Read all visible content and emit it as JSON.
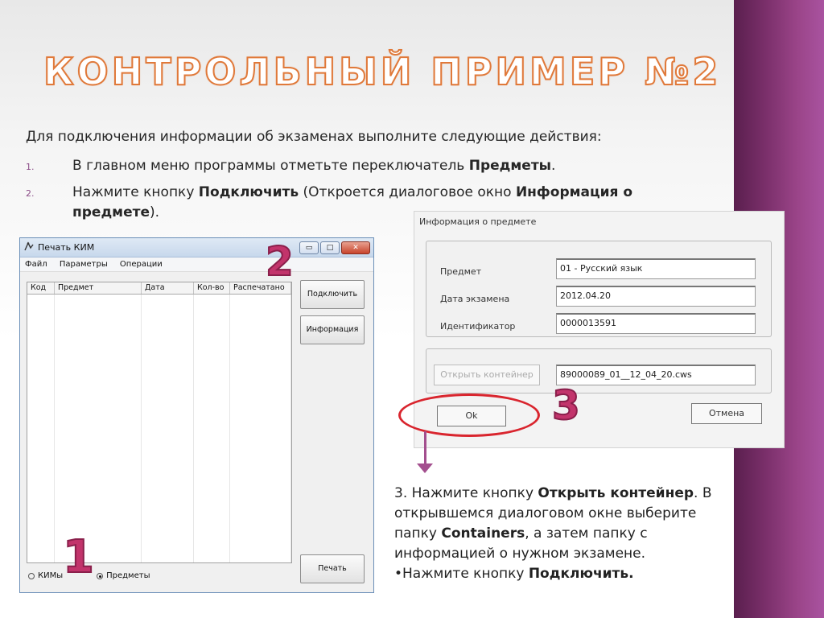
{
  "slide": {
    "title": "КОНТРОЛЬНЫЙ ПРИМЕР №2",
    "intro": "Для подключения информации об экзаменах выполните следующие действия:",
    "steps": [
      {
        "num": "1.",
        "t1": "В главном меню программы отметьте переключатель ",
        "b1": "Предметы",
        "t2": ".",
        "b2": "",
        "t3": ""
      },
      {
        "num": "2.",
        "t1": "Нажмите кнопку ",
        "b1": "Подключить",
        "t2": " (Откроется диалоговое окно ",
        "b2": "Информация о предмете",
        "t3": ")."
      }
    ],
    "step3": {
      "t1": "3. Нажмите кнопку ",
      "b1": "Открыть контейнер",
      "t2": ". В открывшемся диалоговом окне выберите папку ",
      "b2": "Containers",
      "t3": ", а затем папку с информацией о нужном экзамене.",
      "t4": "•Нажмите кнопку ",
      "b3": "Подключить."
    },
    "markers": {
      "one": "1",
      "two": "2",
      "three": "3"
    }
  },
  "window": {
    "title": "Печать КИМ",
    "menu": [
      "Файл",
      "Параметры",
      "Операции"
    ],
    "columns": [
      "Код",
      "Предмет",
      "Дата",
      "Кол-во",
      "Распечатано"
    ],
    "buttons": {
      "connect": "Подключить",
      "info": "Информация",
      "print": "Печать"
    },
    "radios": {
      "kims": "КИМы",
      "subjects": "Предметы",
      "selected": "Предметы"
    }
  },
  "dialog": {
    "title": "Информация о предмете",
    "fields": [
      {
        "label": "Предмет",
        "value": "01 - Русский язык"
      },
      {
        "label": "Дата экзамена",
        "value": "2012.04.20"
      },
      {
        "label": "Идентификатор",
        "value": "0000013591"
      }
    ],
    "open_container_label": "Открыть контейнер",
    "container_value": "89000089_01__12_04_20.cws",
    "ok_label": "Ok",
    "cancel_label": "Отмена"
  },
  "colors": {
    "accent": "#e0793a",
    "marker": "#c2346b",
    "highlight": "#d9252e",
    "band": "#7a2f6a"
  }
}
